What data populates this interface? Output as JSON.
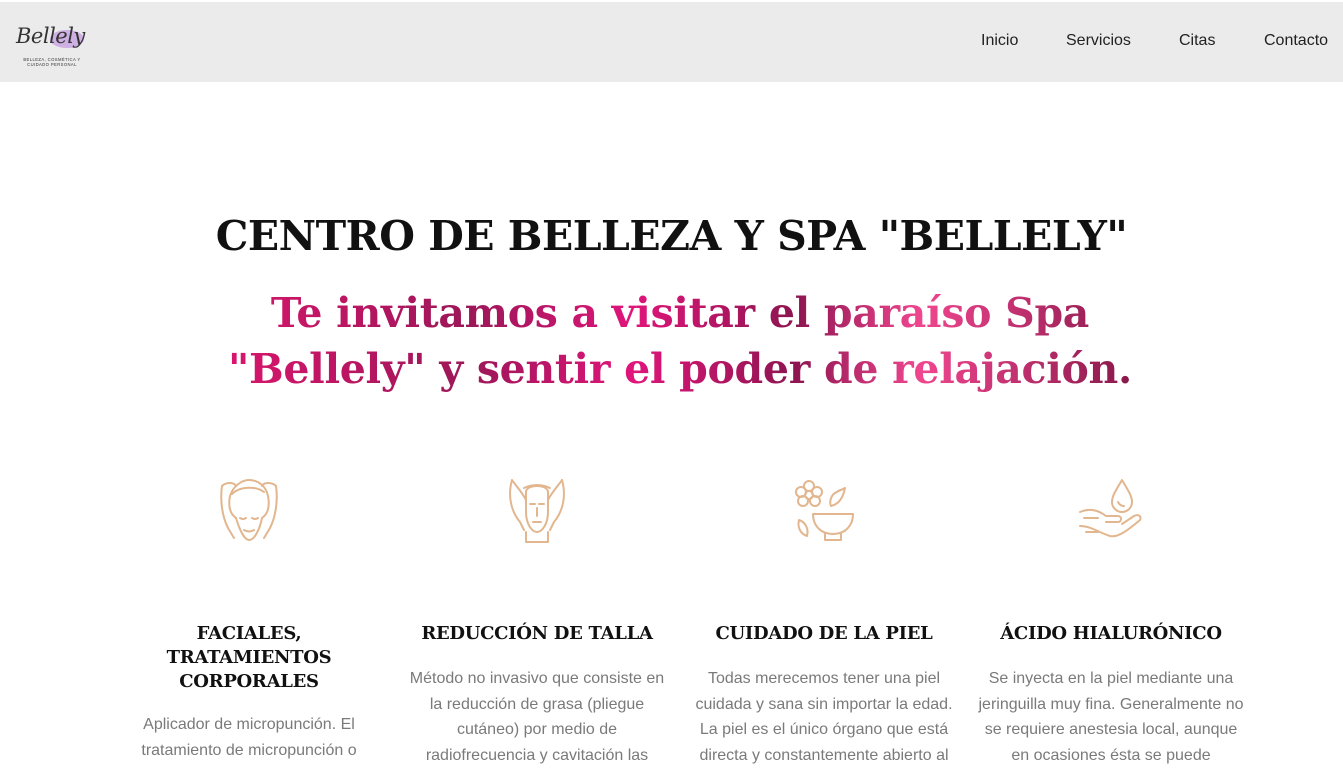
{
  "header": {
    "logo_script": "Bellely",
    "logo_tagline": "BELLEZA, COSMÉTICA Y CUIDADO PERSONAL",
    "nav": [
      "Inicio",
      "Servicios",
      "Citas",
      "Contacto"
    ]
  },
  "hero": {
    "title": "CENTRO DE BELLEZA Y SPA \"BELLELY\"",
    "subtitle": "Te invitamos a visitar el paraíso Spa \"Bellely\" y sentir el poder de relajación."
  },
  "services": [
    {
      "icon": "face-massage-icon",
      "title": "FACIALES, TRATAMIENTOS CORPORALES",
      "text": "Aplicador de micropunción. El tratamiento de micropunción o"
    },
    {
      "icon": "facial-treatment-icon",
      "title": "REDUCCIÓN DE TALLA",
      "text": "Método no invasivo que consiste en la reducción de grasa (pliegue cutáneo) por medio de radiofrecuencia y cavitación las"
    },
    {
      "icon": "flower-bowl-icon",
      "title": "CUIDADO DE LA PIEL",
      "text": "Todas merecemos tener una piel cuidada y sana sin importar la edad. La piel es el único órgano que está directa y constantemente abierto al"
    },
    {
      "icon": "hand-drop-icon",
      "title": "ÁCIDO HIALURÓNICO",
      "text": "Se inyecta en la piel mediante una jeringuilla muy fina. Generalmente no se requiere anestesia local, aunque en ocasiones ésta se puede"
    }
  ],
  "colors": {
    "header_bg": "#ebebeb",
    "icon_stroke": "#e2b68e",
    "accent_pink": "#e0156f",
    "accent_dark": "#8d1550"
  }
}
